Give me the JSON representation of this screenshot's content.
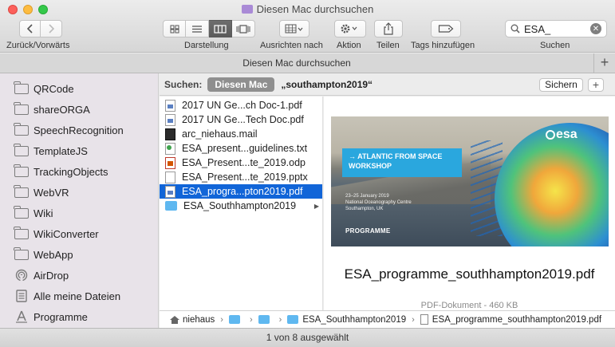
{
  "window": {
    "title": "Diesen Mac durchsuchen"
  },
  "toolbar": {
    "nav_label": "Zurück/Vorwärts",
    "view_label": "Darstellung",
    "arrange_label": "Ausrichten nach",
    "action_label": "Aktion",
    "share_label": "Teilen",
    "tags_label": "Tags hinzufügen",
    "search_label": "Suchen",
    "search_value": "ESA_"
  },
  "tab": {
    "label": "Diesen Mac durchsuchen"
  },
  "sidebar": {
    "items": [
      {
        "label": "QRCode",
        "icon": "folder-icon"
      },
      {
        "label": "shareORGA",
        "icon": "folder-icon"
      },
      {
        "label": "SpeechRecognition",
        "icon": "folder-icon"
      },
      {
        "label": "TemplateJS",
        "icon": "folder-icon"
      },
      {
        "label": "TrackingObjects",
        "icon": "folder-icon"
      },
      {
        "label": "WebVR",
        "icon": "folder-icon"
      },
      {
        "label": "Wiki",
        "icon": "folder-icon"
      },
      {
        "label": "WikiConverter",
        "icon": "folder-icon"
      },
      {
        "label": "WebApp",
        "icon": "folder-icon"
      },
      {
        "label": "AirDrop",
        "icon": "airdrop-icon"
      },
      {
        "label": "Alle meine Dateien",
        "icon": "all-files-icon"
      },
      {
        "label": "Programme",
        "icon": "applications-icon"
      }
    ]
  },
  "scope": {
    "label": "Suchen:",
    "selected": "Diesen Mac",
    "term": "„southampton2019“",
    "save_label": "Sichern",
    "add_label": "+"
  },
  "files": [
    {
      "name": "2017 UN Ge...ch Doc-1.pdf",
      "icon": "pdf-icon"
    },
    {
      "name": "2017 UN Ge...Tech Doc.pdf",
      "icon": "pdf-icon"
    },
    {
      "name": "arc_niehaus.mail",
      "icon": "terminal-icon"
    },
    {
      "name": "ESA_present...guidelines.txt",
      "icon": "text-file-icon"
    },
    {
      "name": "ESA_Present...te_2019.odp",
      "icon": "odp-icon"
    },
    {
      "name": "ESA_Present...te_2019.pptx",
      "icon": "document-icon"
    },
    {
      "name": "ESA_progra...pton2019.pdf",
      "icon": "pdf-icon",
      "selected": true
    },
    {
      "name": "ESA_Southhampton2019",
      "icon": "folder-icon",
      "folder": true
    }
  ],
  "preview": {
    "filename": "ESA_programme_southhampton2019.pdf",
    "kind": "PDF-Dokument - 460 KB",
    "thumb": {
      "banner": "→ ATLANTIC FROM SPACE\nWORKSHOP",
      "details": "23–25 January 2019\nNational Oceanography Centre\nSouthampton, UK",
      "heading": "PROGRAMME",
      "logo": "esa"
    }
  },
  "pathbar": {
    "home": "niehaus",
    "folder": "ESA_Southhampton2019",
    "file": "ESA_programme_southhampton2019.pdf"
  },
  "status": {
    "text": "1 von 8 ausgewählt"
  },
  "colors": {
    "selection": "#1165d8",
    "folder": "#5fb8f0",
    "sidebar": "#e8e3e9"
  }
}
